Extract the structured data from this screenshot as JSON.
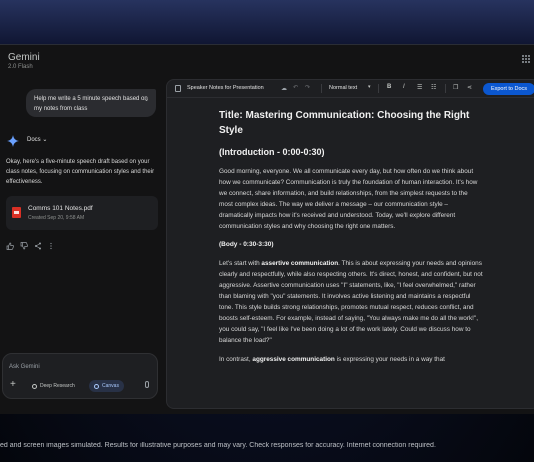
{
  "app": {
    "title": "Gemini",
    "model": "2.0 Flash"
  },
  "chat": {
    "user_message": "Help me write a 5 minute speech based on my notes from class",
    "docs_label": "Docs",
    "reply_text": "Okay, here's a five-minute speech draft based on your class notes, focusing on communication styles and their effectiveness.",
    "file": {
      "name": "Comms 101 Notes.pdf",
      "meta": "Created Sep 20, 9:58 AM"
    },
    "input_placeholder": "Ask Gemini",
    "deep_research_label": "Deep Research",
    "canvas_label": "Canvas"
  },
  "canvas": {
    "doc_title": "Speaker Notes for Presentation",
    "format_select": "Normal text",
    "export_label": "Export to Docs",
    "toolbar_bold": "B",
    "toolbar_italic": "I",
    "heading": "Title: Mastering Communication: Choosing the Right Style",
    "section_intro": "(Introduction - 0:00-0:30)",
    "intro_text": "Good morning, everyone. We all communicate every day, but how often do we think about how we communicate? Communication is truly the foundation of human interaction. It's how we connect, share information, and build relationships, from the simplest requests to the most complex ideas. The way we deliver a message – our communication style – dramatically impacts how it's received and understood. Today, we'll explore different communication styles and why choosing the right one matters.",
    "section_body": "(Body - 0:30-3:30)",
    "body_p1_pre": "Let's start with ",
    "body_p1_bold": "assertive communication",
    "body_p1_post": ". This is about expressing your needs and opinions clearly and respectfully, while also respecting others. It's direct, honest, and confident, but not aggressive. Assertive communication uses \"I\" statements, like, \"I feel overwhelmed,\" rather than blaming with \"you\" statements. It involves active listening and maintains a respectful tone. This style builds strong relationships, promotes mutual respect, reduces conflict, and boosts self-esteem. For example, instead of saying, \"You always make me do all the work!\", you could say, \"I feel like I've been doing a lot of the work lately. Could we discuss how to balance the load?\"",
    "body_p2_pre": "In contrast, ",
    "body_p2_bold": "aggressive communication",
    "body_p2_post": " is expressing your needs in a way that"
  },
  "footer": {
    "disclaimer": "ed and screen images simulated. Results for illustrative purposes and may vary. Check responses for accuracy. Internet connection required."
  },
  "colors": {
    "accent": "#0b57d0",
    "pdf": "#d93025",
    "canvas_chip": "#a8c7fa"
  }
}
